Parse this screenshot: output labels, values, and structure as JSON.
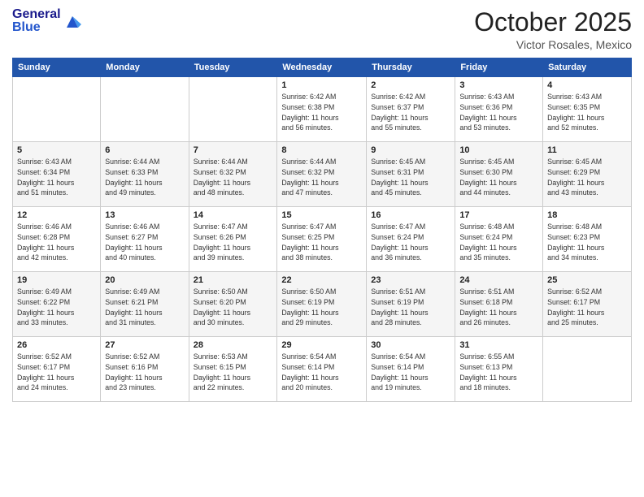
{
  "header": {
    "logo_general": "General",
    "logo_blue": "Blue",
    "month": "October 2025",
    "location": "Victor Rosales, Mexico"
  },
  "days_of_week": [
    "Sunday",
    "Monday",
    "Tuesday",
    "Wednesday",
    "Thursday",
    "Friday",
    "Saturday"
  ],
  "weeks": [
    [
      {
        "day": "",
        "info": ""
      },
      {
        "day": "",
        "info": ""
      },
      {
        "day": "",
        "info": ""
      },
      {
        "day": "1",
        "info": "Sunrise: 6:42 AM\nSunset: 6:38 PM\nDaylight: 11 hours\nand 56 minutes."
      },
      {
        "day": "2",
        "info": "Sunrise: 6:42 AM\nSunset: 6:37 PM\nDaylight: 11 hours\nand 55 minutes."
      },
      {
        "day": "3",
        "info": "Sunrise: 6:43 AM\nSunset: 6:36 PM\nDaylight: 11 hours\nand 53 minutes."
      },
      {
        "day": "4",
        "info": "Sunrise: 6:43 AM\nSunset: 6:35 PM\nDaylight: 11 hours\nand 52 minutes."
      }
    ],
    [
      {
        "day": "5",
        "info": "Sunrise: 6:43 AM\nSunset: 6:34 PM\nDaylight: 11 hours\nand 51 minutes."
      },
      {
        "day": "6",
        "info": "Sunrise: 6:44 AM\nSunset: 6:33 PM\nDaylight: 11 hours\nand 49 minutes."
      },
      {
        "day": "7",
        "info": "Sunrise: 6:44 AM\nSunset: 6:32 PM\nDaylight: 11 hours\nand 48 minutes."
      },
      {
        "day": "8",
        "info": "Sunrise: 6:44 AM\nSunset: 6:32 PM\nDaylight: 11 hours\nand 47 minutes."
      },
      {
        "day": "9",
        "info": "Sunrise: 6:45 AM\nSunset: 6:31 PM\nDaylight: 11 hours\nand 45 minutes."
      },
      {
        "day": "10",
        "info": "Sunrise: 6:45 AM\nSunset: 6:30 PM\nDaylight: 11 hours\nand 44 minutes."
      },
      {
        "day": "11",
        "info": "Sunrise: 6:45 AM\nSunset: 6:29 PM\nDaylight: 11 hours\nand 43 minutes."
      }
    ],
    [
      {
        "day": "12",
        "info": "Sunrise: 6:46 AM\nSunset: 6:28 PM\nDaylight: 11 hours\nand 42 minutes."
      },
      {
        "day": "13",
        "info": "Sunrise: 6:46 AM\nSunset: 6:27 PM\nDaylight: 11 hours\nand 40 minutes."
      },
      {
        "day": "14",
        "info": "Sunrise: 6:47 AM\nSunset: 6:26 PM\nDaylight: 11 hours\nand 39 minutes."
      },
      {
        "day": "15",
        "info": "Sunrise: 6:47 AM\nSunset: 6:25 PM\nDaylight: 11 hours\nand 38 minutes."
      },
      {
        "day": "16",
        "info": "Sunrise: 6:47 AM\nSunset: 6:24 PM\nDaylight: 11 hours\nand 36 minutes."
      },
      {
        "day": "17",
        "info": "Sunrise: 6:48 AM\nSunset: 6:24 PM\nDaylight: 11 hours\nand 35 minutes."
      },
      {
        "day": "18",
        "info": "Sunrise: 6:48 AM\nSunset: 6:23 PM\nDaylight: 11 hours\nand 34 minutes."
      }
    ],
    [
      {
        "day": "19",
        "info": "Sunrise: 6:49 AM\nSunset: 6:22 PM\nDaylight: 11 hours\nand 33 minutes."
      },
      {
        "day": "20",
        "info": "Sunrise: 6:49 AM\nSunset: 6:21 PM\nDaylight: 11 hours\nand 31 minutes."
      },
      {
        "day": "21",
        "info": "Sunrise: 6:50 AM\nSunset: 6:20 PM\nDaylight: 11 hours\nand 30 minutes."
      },
      {
        "day": "22",
        "info": "Sunrise: 6:50 AM\nSunset: 6:19 PM\nDaylight: 11 hours\nand 29 minutes."
      },
      {
        "day": "23",
        "info": "Sunrise: 6:51 AM\nSunset: 6:19 PM\nDaylight: 11 hours\nand 28 minutes."
      },
      {
        "day": "24",
        "info": "Sunrise: 6:51 AM\nSunset: 6:18 PM\nDaylight: 11 hours\nand 26 minutes."
      },
      {
        "day": "25",
        "info": "Sunrise: 6:52 AM\nSunset: 6:17 PM\nDaylight: 11 hours\nand 25 minutes."
      }
    ],
    [
      {
        "day": "26",
        "info": "Sunrise: 6:52 AM\nSunset: 6:17 PM\nDaylight: 11 hours\nand 24 minutes."
      },
      {
        "day": "27",
        "info": "Sunrise: 6:52 AM\nSunset: 6:16 PM\nDaylight: 11 hours\nand 23 minutes."
      },
      {
        "day": "28",
        "info": "Sunrise: 6:53 AM\nSunset: 6:15 PM\nDaylight: 11 hours\nand 22 minutes."
      },
      {
        "day": "29",
        "info": "Sunrise: 6:54 AM\nSunset: 6:14 PM\nDaylight: 11 hours\nand 20 minutes."
      },
      {
        "day": "30",
        "info": "Sunrise: 6:54 AM\nSunset: 6:14 PM\nDaylight: 11 hours\nand 19 minutes."
      },
      {
        "day": "31",
        "info": "Sunrise: 6:55 AM\nSunset: 6:13 PM\nDaylight: 11 hours\nand 18 minutes."
      },
      {
        "day": "",
        "info": ""
      }
    ]
  ]
}
